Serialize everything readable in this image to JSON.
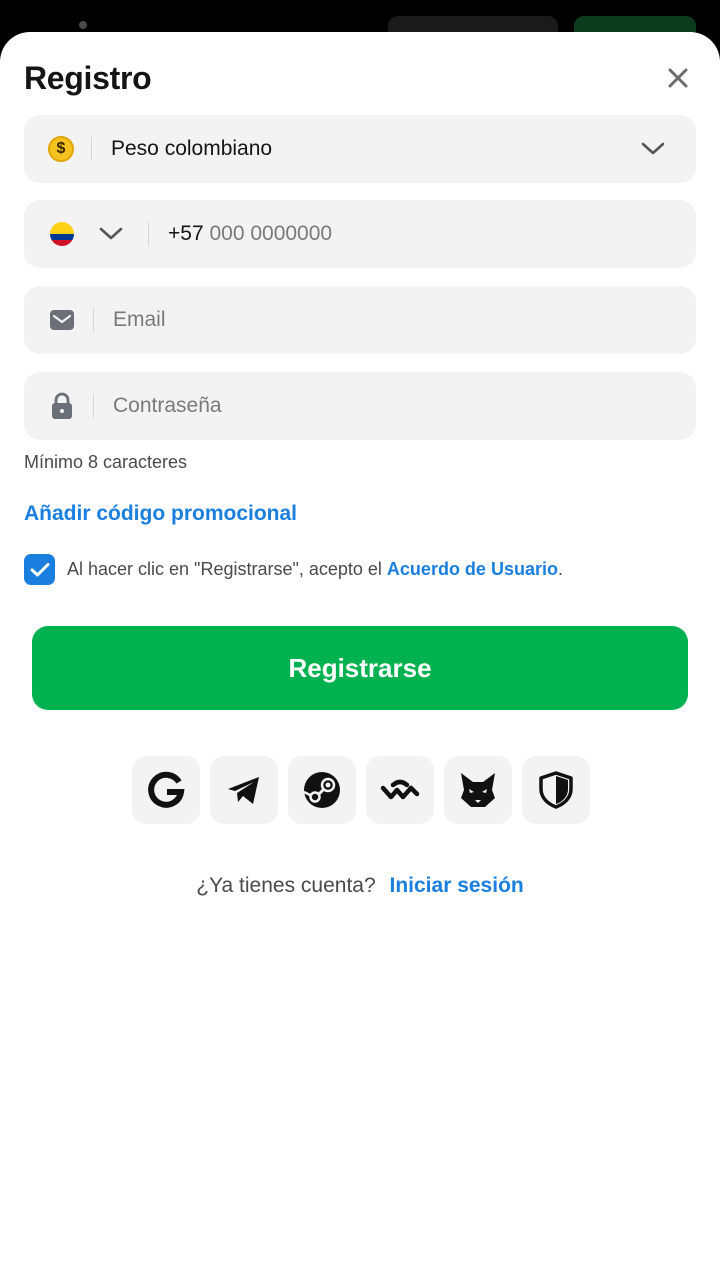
{
  "header": {
    "title": "Registro"
  },
  "currency": {
    "icon_symbol": "$",
    "value": "Peso colombiano"
  },
  "phone": {
    "country_code": "+57",
    "placeholder": "000 0000000"
  },
  "email": {
    "placeholder": "Email"
  },
  "password": {
    "placeholder": "Contraseña",
    "hint": "Mínimo 8 caracteres"
  },
  "promo": {
    "label": "Añadir código promocional"
  },
  "agreement": {
    "checked": true,
    "text": "Al hacer clic en \"Registrarse\", acepto el ",
    "link": "Acuerdo de Usuario",
    "suffix": "."
  },
  "register_button": {
    "label": "Registrarse"
  },
  "social": [
    "google-icon",
    "telegram-icon",
    "steam-icon",
    "walletconnect-icon",
    "metamask-fox-icon",
    "shield-icon"
  ],
  "login": {
    "question": "¿Ya tienes cuenta?",
    "link": "Iniciar sesión"
  },
  "colors": {
    "accent": "#1b7fe0",
    "primary_button": "#00b14f",
    "field_bg": "#f3f3f3"
  }
}
